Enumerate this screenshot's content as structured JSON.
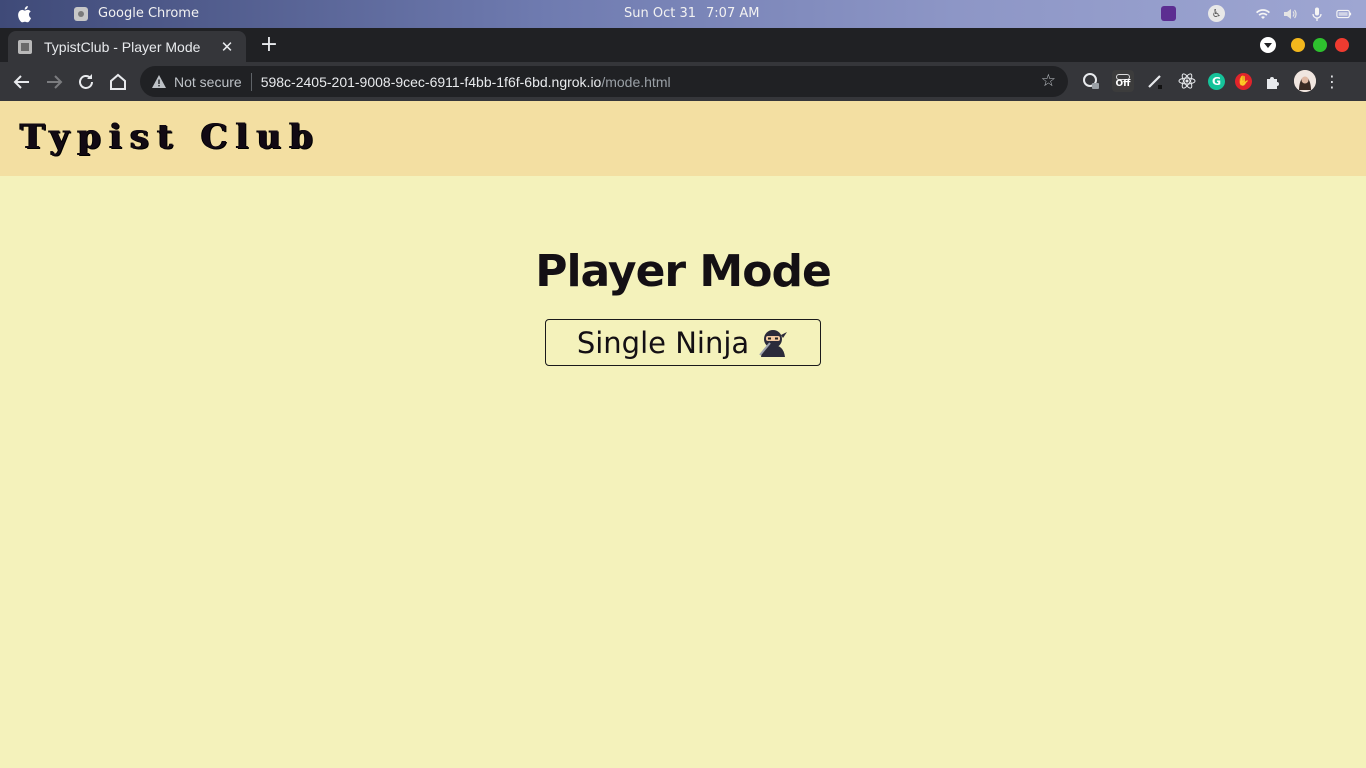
{
  "os": {
    "app_name": "Google Chrome",
    "date": "Sun Oct 31",
    "time": "7:07 AM"
  },
  "browser": {
    "tab_title": "TypistClub - Player Mode",
    "security_label": "Not secure",
    "url_host": "598c-2405-201-9008-9cec-6911-f4bb-1f6f-6bd.ngrok.io",
    "url_path": "/mode.html",
    "extensions": [
      {
        "name": "color-picker",
        "label": ""
      },
      {
        "name": "off-toggle",
        "label": "Off"
      },
      {
        "name": "pen",
        "label": ""
      },
      {
        "name": "react-devtools",
        "label": ""
      },
      {
        "name": "grammarly",
        "label": "G"
      },
      {
        "name": "block-hand",
        "label": ""
      }
    ]
  },
  "site": {
    "logo": "Typist Club"
  },
  "main": {
    "title": "Player Mode",
    "mode_button_label": "Single Ninja"
  },
  "colors": {
    "page_background": "#f4f2bb",
    "header_background": "#f3dfa2",
    "text_dark": "#141014"
  }
}
